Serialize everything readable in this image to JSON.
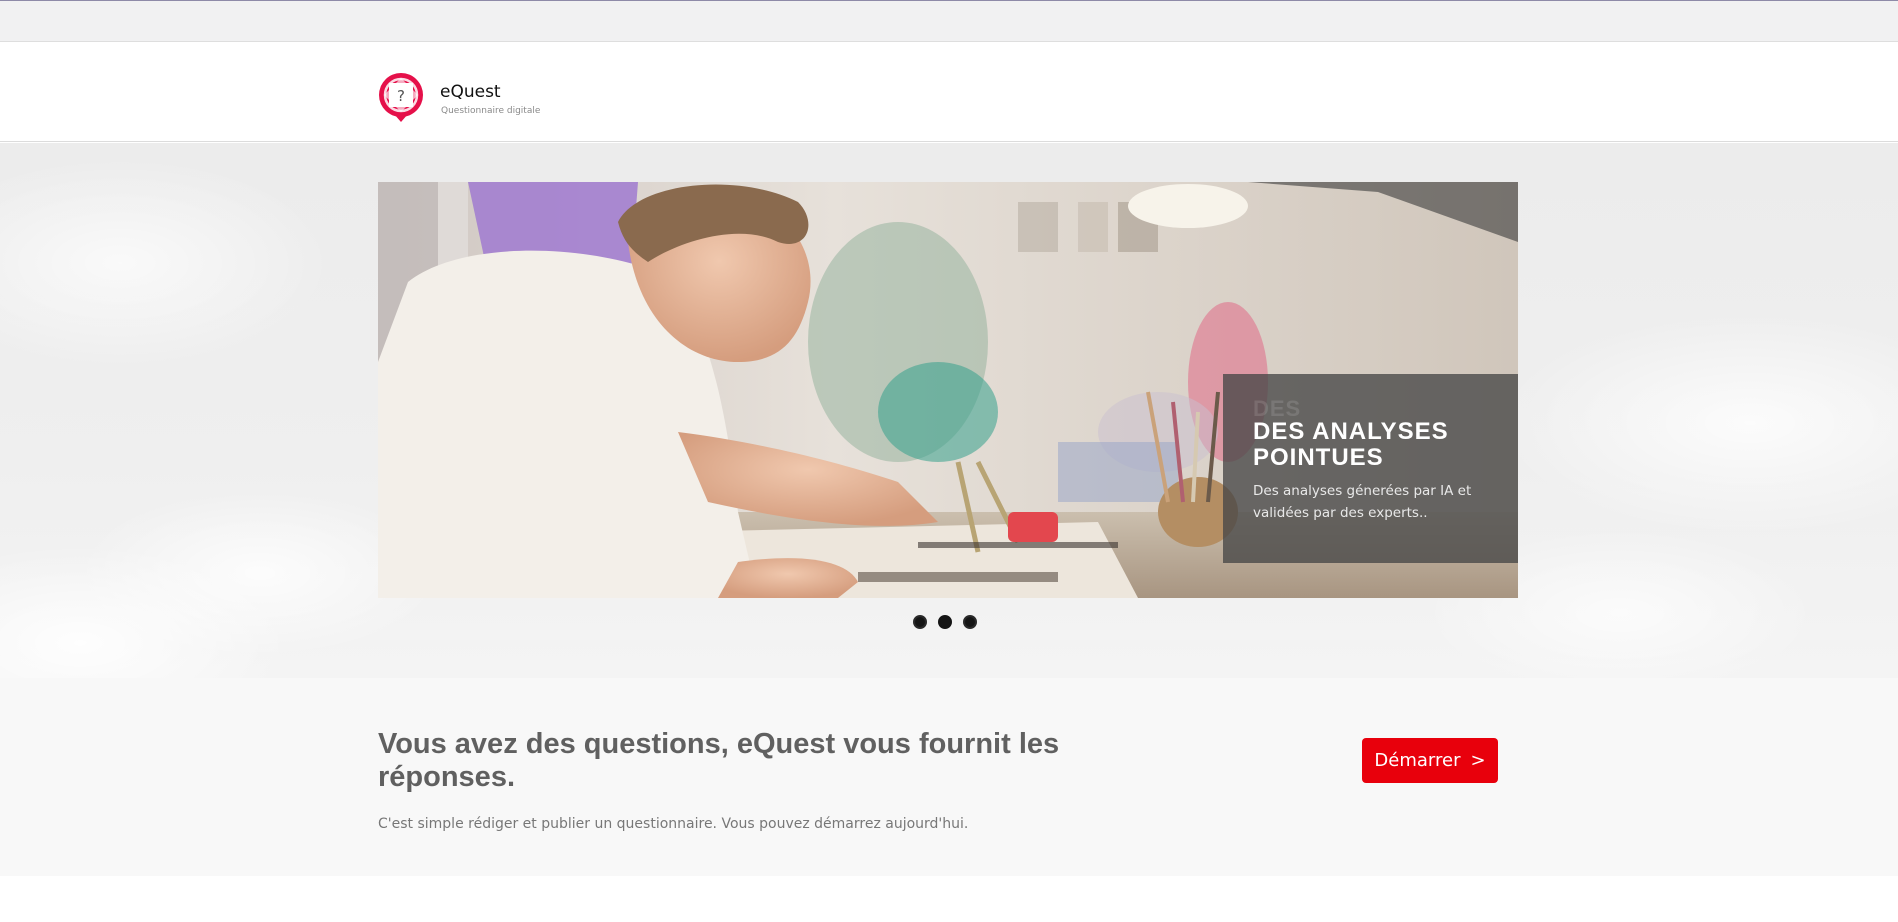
{
  "brand": {
    "name": "eQuest",
    "tagline": "Questionnaire digitale",
    "logo_mark": "?",
    "logo_icon": "question-badge-icon",
    "logo_color": "#e5104a"
  },
  "carousel": {
    "caption": {
      "ghost_text": "DES",
      "title": "DES ANALYSES POINTUES",
      "text": "Des analyses génerées par IA et validées par des experts.."
    },
    "indicators_count": 3,
    "active_index": 1
  },
  "cta": {
    "heading": "Vous avez des questions, eQuest vous fournit les réponses.",
    "subtitle": "C'est simple rédiger et publier un questionnaire. Vous pouvez démarrez aujourd'hui.",
    "button_label": "Démarrer",
    "button_chevron": ">",
    "button_color": "#e8000c"
  }
}
